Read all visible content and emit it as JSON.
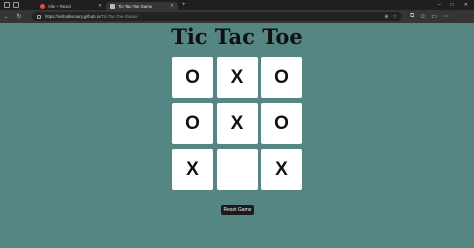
{
  "browser": {
    "tabs": [
      {
        "label": "Vite + React",
        "active": false
      },
      {
        "label": "Tic-Tac-Toe Game",
        "active": true
      }
    ],
    "new_tab": "+",
    "url_host": "https://vishalkumary.github.io",
    "url_path": "/Tic-Tac-Toe-Game/",
    "window_controls": [
      "–",
      "□",
      "✕"
    ]
  },
  "page": {
    "title": "Tic Tac Toe",
    "board": [
      "O",
      "X",
      "O",
      "O",
      "X",
      "O",
      "X",
      "",
      "X"
    ],
    "reset_label": "Reset Game"
  },
  "colors": {
    "background": "#568683",
    "cell": "#ffffff",
    "button": "#1b1b1b"
  }
}
